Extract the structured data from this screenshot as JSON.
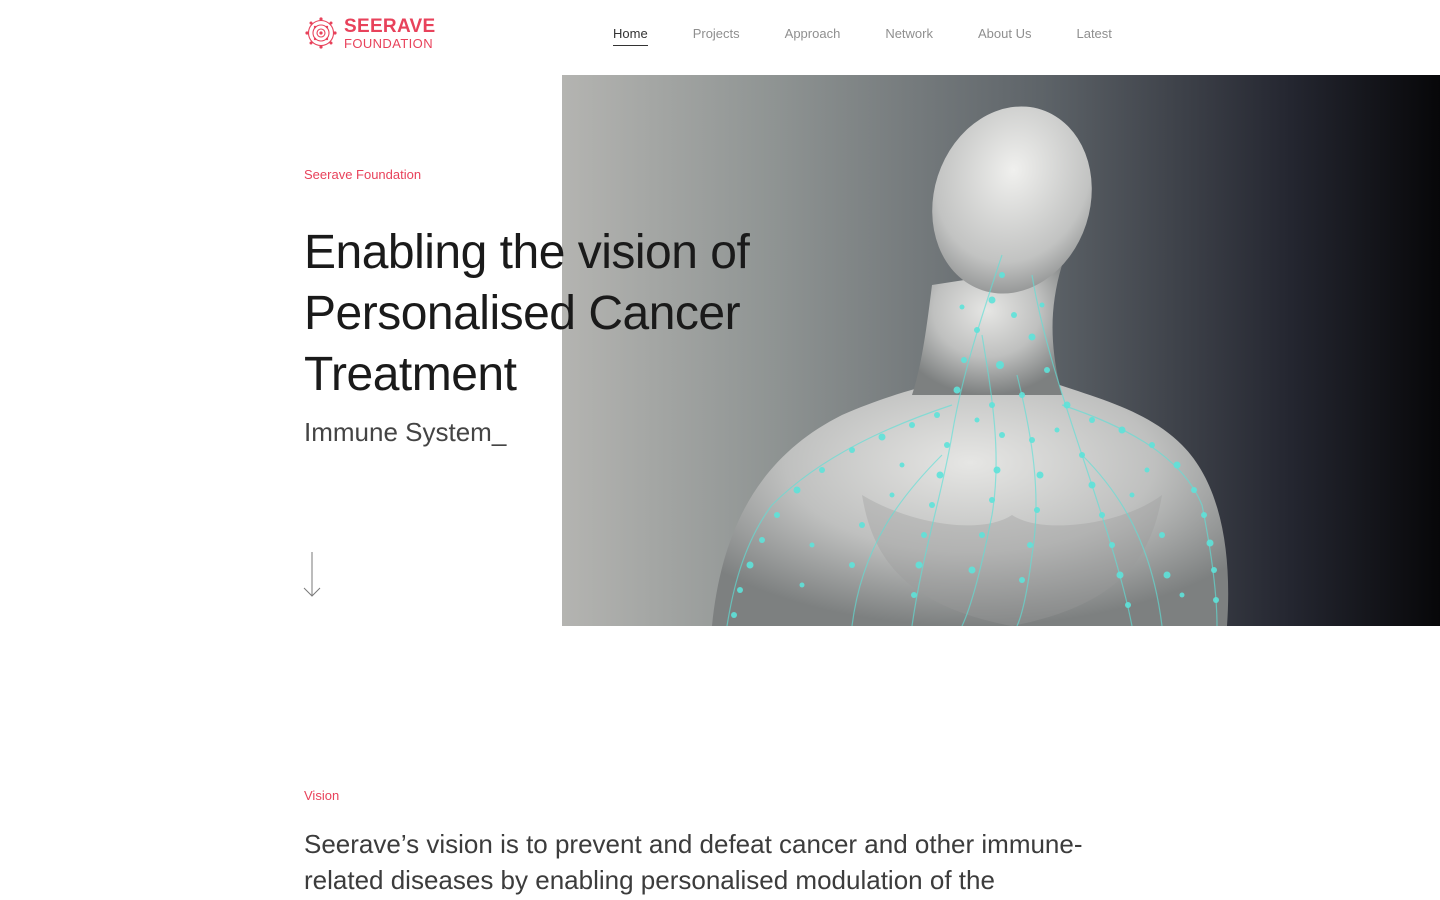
{
  "brand": {
    "name_line1": "SEERAVE",
    "name_line2": "FOUNDATION",
    "accent_color": "#e8425b"
  },
  "nav": {
    "items": [
      {
        "label": "Home",
        "active": true
      },
      {
        "label": "Projects",
        "active": false
      },
      {
        "label": "Approach",
        "active": false
      },
      {
        "label": "Network",
        "active": false
      },
      {
        "label": "About Us",
        "active": false
      },
      {
        "label": "Latest",
        "active": false
      }
    ]
  },
  "hero": {
    "eyebrow": "Seerave Foundation",
    "title": "Enabling the vision of Personalised Cancer Treatment",
    "subtitle": "Immune System_",
    "scroll_icon": "arrow-down-icon"
  },
  "vision": {
    "eyebrow": "Vision",
    "text": "Seerave’s vision is to prevent and defeat cancer and other immune-related diseases by enabling personalised modulation of the"
  }
}
